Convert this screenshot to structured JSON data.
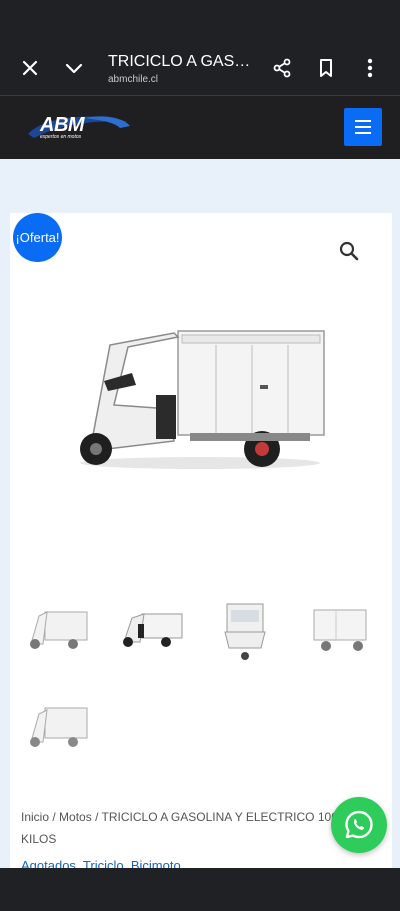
{
  "browser": {
    "title": "TRICICLO A GASOLINA Y ELECTRICO 1000 KILOS",
    "url": "abmchile.cl",
    "icons": [
      "close-icon",
      "chevron-down-icon",
      "share-icon",
      "bookmark-icon",
      "more-vert-icon"
    ]
  },
  "header": {
    "logo_text": "ABM",
    "logo_tagline": "expertos en motos",
    "menu_icon": "menu-icon",
    "accent_color": "#0a6cf5"
  },
  "product": {
    "sale_badge": "¡Oferta!",
    "zoom_icon": "search-icon",
    "breadcrumb": {
      "home": "Inicio",
      "separator": "/",
      "category": "Motos",
      "current": "TRICICLO A GASOLINA Y ELECTRICO 1000 KILOS"
    },
    "categories_text": "Agotados, Triciclo, Bicimoto"
  },
  "whatsapp_icon": "whatsapp-icon",
  "colors": {
    "page_bg": "#e8f1fa",
    "header_bg": "#1f1f21",
    "whatsapp": "#2ecc5a"
  }
}
